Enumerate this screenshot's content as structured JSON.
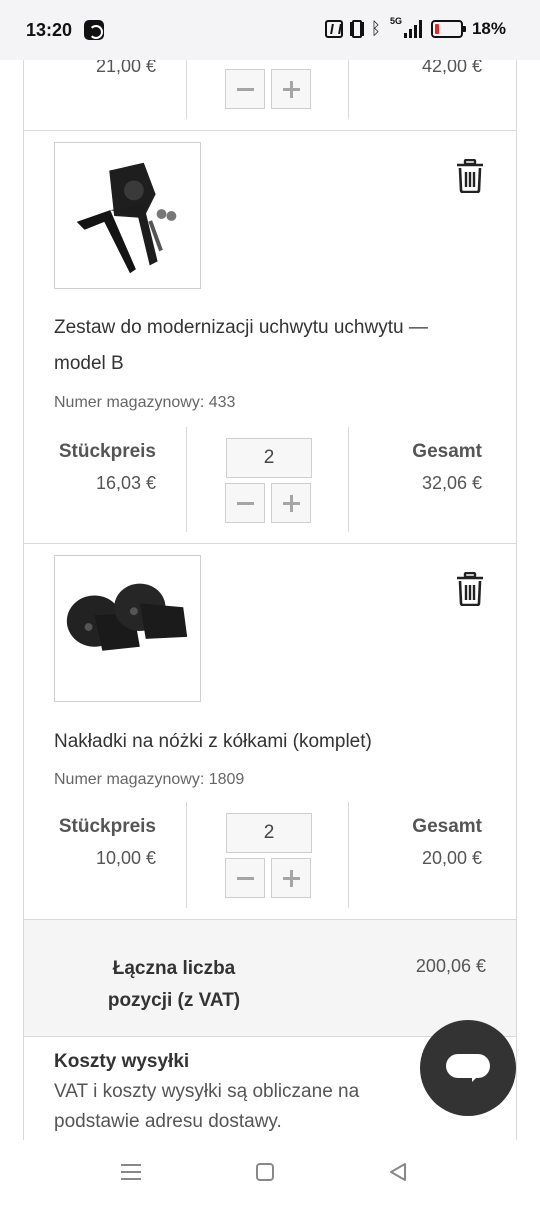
{
  "status_bar": {
    "time": "13:20",
    "network_tag": "5G",
    "battery_percent": "18%",
    "icons": [
      "app-notification-icon",
      "nfc-icon",
      "vibrate-icon",
      "bluetooth-icon",
      "signal-icon",
      "battery-icon"
    ]
  },
  "top_partial_item": {
    "unit_price": "21,00 €",
    "total": "42,00 €"
  },
  "items": [
    {
      "name": "Zestaw do modernizacji uchwytu uchwytu — model B",
      "sku": "Numer magazynowy: 433",
      "unit_price_label": "Stückpreis",
      "unit_price": "16,03 €",
      "quantity": "2",
      "total_label": "Gesamt",
      "total": "32,06 €"
    },
    {
      "name": "Nakładki na nóżki z kółkami (komplet)",
      "sku": "Numer magazynowy: 1809",
      "unit_price_label": "Stückpreis",
      "unit_price": "10,00 €",
      "quantity": "2",
      "total_label": "Gesamt",
      "total": "20,00 €"
    }
  ],
  "summary": {
    "label": "Łączna liczba pozycji (z VAT)",
    "value": "200,06 €"
  },
  "shipping": {
    "title": "Koszty wysyłki",
    "text": "VAT i koszty wysyłki są obliczane na podstawie adresu dostawy."
  },
  "colors": {
    "fab": "#333333",
    "border": "#d9d9d9",
    "summary_bg": "#f5f5f5"
  }
}
